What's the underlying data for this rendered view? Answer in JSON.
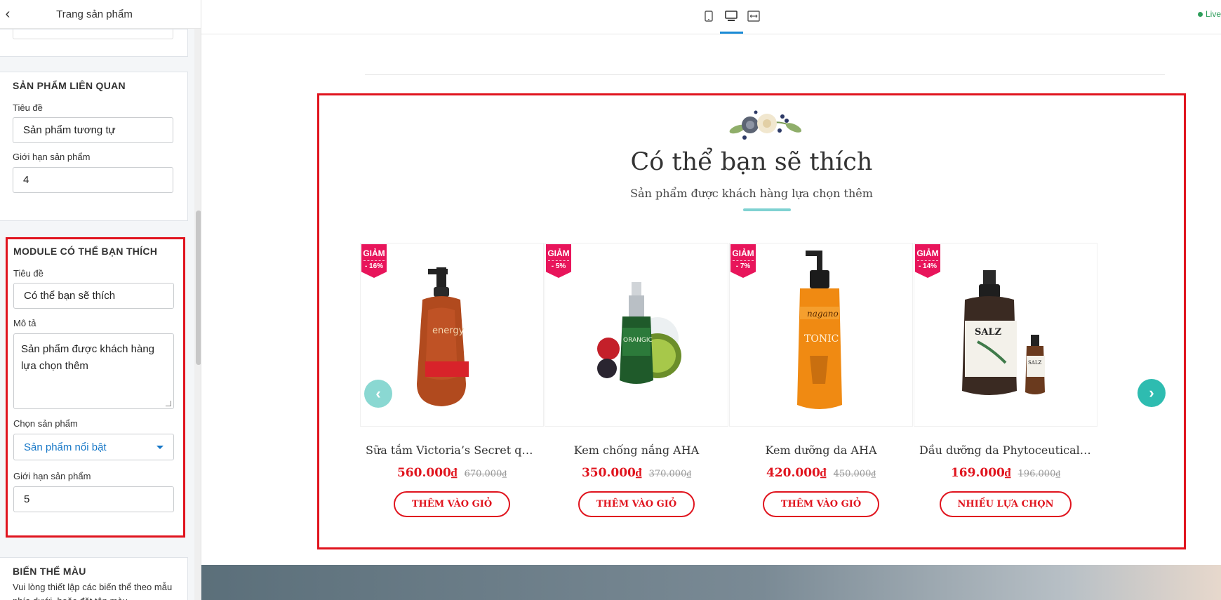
{
  "sidebar": {
    "title": "Trang sản phẩm",
    "related": {
      "heading": "SẢN PHẨM LIÊN QUAN",
      "title_label": "Tiêu đề",
      "title_value": "Sản phẩm tương tự",
      "limit_label": "Giới hạn sản phẩm",
      "limit_value": "4"
    },
    "module": {
      "heading": "MODULE CÓ THỂ BẠN THÍCH",
      "title_label": "Tiêu đề",
      "title_value": "Có thể bạn sẽ thích",
      "desc_label": "Mô tả",
      "desc_value": "Sản phẩm được khách hàng lựa chọn thêm",
      "choose_label": "Chọn sản phẩm",
      "choose_value": "Sản phẩm nổi bật",
      "limit_label": "Giới hạn sản phẩm",
      "limit_value": "5"
    },
    "variant": {
      "heading": "BIẾN THỂ MÀU",
      "text": "Vui lòng thiết lập các biến thể theo mẫu phía dưới, hoặc đặt tên màu"
    }
  },
  "toolbar": {
    "devices": [
      "mobile-icon",
      "desktop-icon",
      "fullwidth-icon"
    ],
    "active_device": "desktop",
    "live_label": "Live"
  },
  "preview": {
    "section_title": "Có thể bạn sẽ thích",
    "section_subtitle": "Sản phẩm được khách hàng lựa chọn thêm",
    "products": [
      {
        "badge": "GIẢM",
        "discount": "- 16%",
        "name": "Sữa tắm Victoria’s Secret quy...",
        "price": "560.000₫",
        "old_price": "670.000₫",
        "button": "THÊM VÀO GIỎ"
      },
      {
        "badge": "GIẢM",
        "discount": "- 5%",
        "name": "Kem chống nắng AHA",
        "price": "350.000₫",
        "old_price": "370.000₫",
        "button": "THÊM VÀO GIỎ"
      },
      {
        "badge": "GIẢM",
        "discount": "- 7%",
        "name": "Kem dưỡng da AHA",
        "price": "420.000₫",
        "old_price": "450.000₫",
        "button": "THÊM VÀO GIỎ"
      },
      {
        "badge": "GIẢM",
        "discount": "- 14%",
        "name": "Dầu dưỡng da Phytoceuticals...",
        "price": "169.000₫",
        "old_price": "196.000₫",
        "button": "NHIỀU LỰA CHỌN"
      }
    ],
    "product_labels": [
      {
        "line1": "energy",
        "line2": ""
      },
      {
        "line1": "ORANGIC",
        "line2": ""
      },
      {
        "line1": "nagano",
        "line2": "TONIC"
      },
      {
        "line1": "SALZ",
        "line2": "SALZ"
      }
    ],
    "nav_prev": "‹",
    "nav_next": "›"
  },
  "colors": {
    "accent_red": "#e0141e",
    "badge_pink": "#e8155b",
    "teal": "#2ebcb0",
    "link_blue": "#1677c7"
  }
}
